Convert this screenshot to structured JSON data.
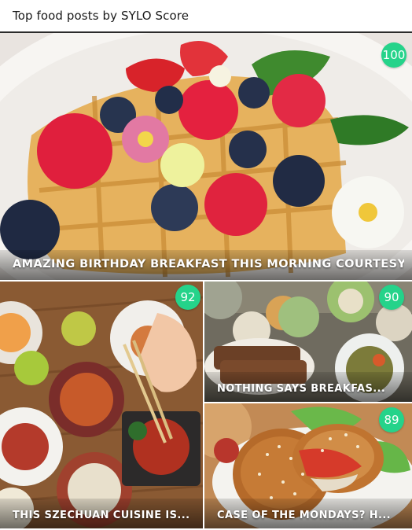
{
  "header": {
    "title": "Top food posts by SYLO Score"
  },
  "accent_color": "#25d38a",
  "posts": [
    {
      "caption": "AMAZING BIRTHDAY BREAKFAST THIS MORNING COURTESY...",
      "score": "100",
      "image": "waffle-with-berries"
    },
    {
      "caption": "THIS SZECHUAN CUISINE IS...",
      "score": "92",
      "image": "szechuan-dishes-table"
    },
    {
      "caption": "NOTHING SAYS BREAKFAS...",
      "score": "90",
      "image": "breakfast-spread"
    },
    {
      "caption": "CASE OF THE MONDAYS? H...",
      "score": "89",
      "image": "bagel-sandwich"
    }
  ]
}
